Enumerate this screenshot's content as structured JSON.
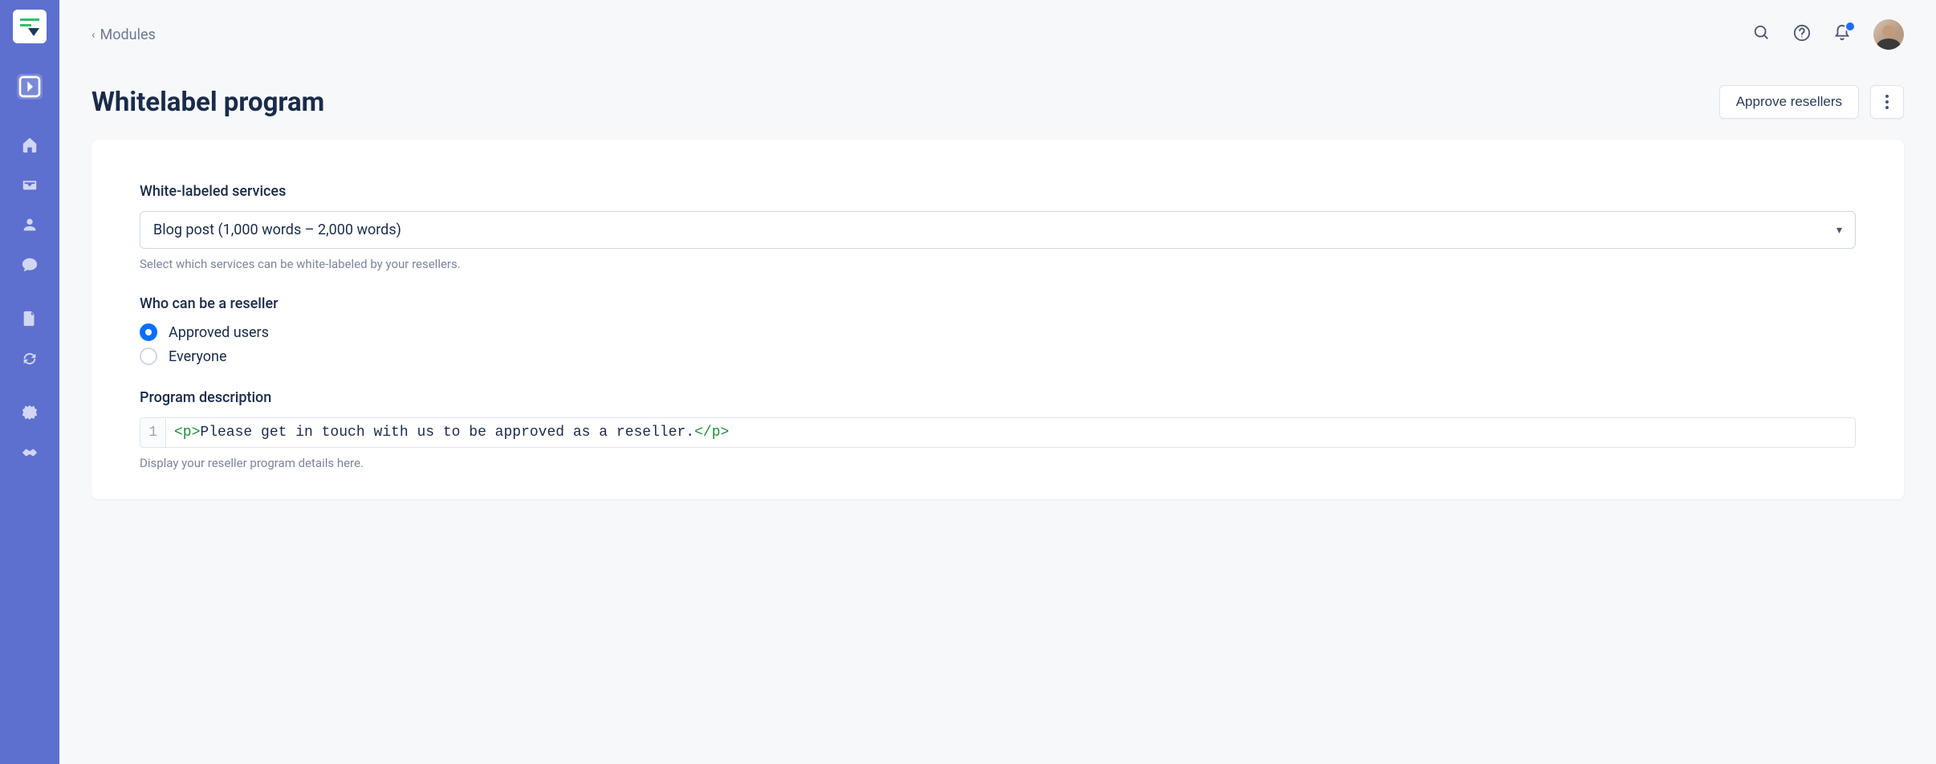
{
  "breadcrumb": {
    "label": "Modules"
  },
  "page": {
    "title": "Whitelabel program",
    "approve_button": "Approve resellers"
  },
  "services": {
    "label": "White-labeled services",
    "selected": "Blog post (1,000 words – 2,000 words)",
    "help": "Select which services can be white-labeled by your resellers."
  },
  "reseller": {
    "label": "Who can be a reseller",
    "options": {
      "approved": "Approved users",
      "everyone": "Everyone"
    },
    "selected": "approved"
  },
  "description": {
    "label": "Program description",
    "line_number": "1",
    "tag_open": "<p>",
    "content": "Please get in touch with us to be approved as a reseller.",
    "tag_close": "</p>",
    "help": "Display your reseller program details here."
  }
}
